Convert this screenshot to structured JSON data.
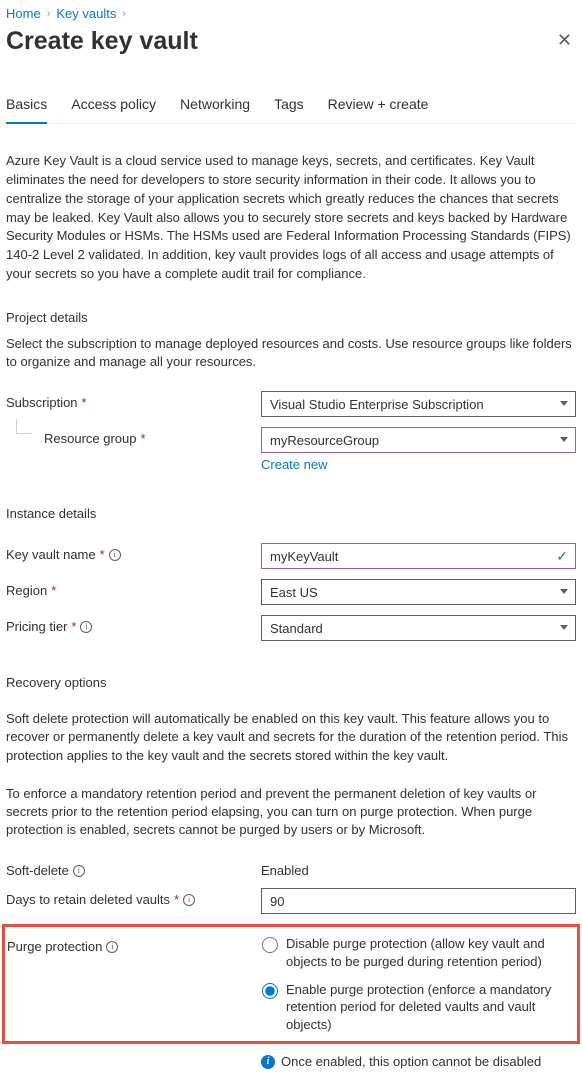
{
  "breadcrumb": {
    "home": "Home",
    "keyvaults": "Key vaults"
  },
  "title": "Create key vault",
  "tabs": {
    "basics": "Basics",
    "access": "Access policy",
    "networking": "Networking",
    "tags": "Tags",
    "review": "Review + create"
  },
  "intro": "Azure Key Vault is a cloud service used to manage keys, secrets, and certificates. Key Vault eliminates the need for developers to store security information in their code. It allows you to centralize the storage of your application secrets which greatly reduces the chances that secrets may be leaked. Key Vault also allows you to securely store secrets and keys backed by Hardware Security Modules or HSMs. The HSMs used are Federal Information Processing Standards (FIPS) 140-2 Level 2 validated. In addition, key vault provides logs of all access and usage attempts of your secrets so you have a complete audit trail for compliance.",
  "project": {
    "title": "Project details",
    "desc": "Select the subscription to manage deployed resources and costs. Use resource groups like folders to organize and manage all your resources.",
    "sub_label": "Subscription",
    "sub_value": "Visual Studio Enterprise Subscription",
    "rg_label": "Resource group",
    "rg_value": "myResourceGroup",
    "create_new": "Create new"
  },
  "instance": {
    "title": "Instance details",
    "name_label": "Key vault name",
    "name_value": "myKeyVault",
    "region_label": "Region",
    "region_value": "East US",
    "tier_label": "Pricing tier",
    "tier_value": "Standard"
  },
  "recovery": {
    "title": "Recovery options",
    "desc1": "Soft delete protection will automatically be enabled on this key vault. This feature allows you to recover or permanently delete a key vault and secrets for the duration of the retention period. This protection applies to the key vault and the secrets stored within the key vault.",
    "desc2": "To enforce a mandatory retention period and prevent the permanent deletion of key vaults or secrets prior to the retention period elapsing, you can turn on purge protection. When purge protection is enabled, secrets cannot be purged by users or by Microsoft.",
    "softdelete_label": "Soft-delete",
    "softdelete_value": "Enabled",
    "days_label": "Days to retain deleted vaults",
    "days_value": "90",
    "purge_label": "Purge protection",
    "purge_opt1": "Disable purge protection (allow key vault and objects to be purged during retention period)",
    "purge_opt2": "Enable purge protection (enforce a mandatory retention period for deleted vaults and vault objects)",
    "purge_note": "Once enabled, this option cannot be disabled"
  }
}
